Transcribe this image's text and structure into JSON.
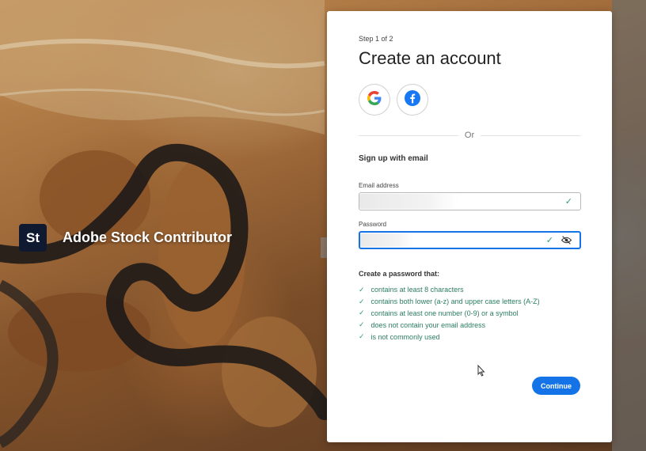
{
  "brand": {
    "logo_text": "St",
    "name": "Adobe Stock Contributor"
  },
  "form": {
    "step": "Step 1 of 2",
    "title": "Create an account",
    "social": [
      {
        "provider": "Google",
        "icon": "google-icon"
      },
      {
        "provider": "Facebook",
        "icon": "facebook-icon"
      }
    ],
    "divider_text": "Or",
    "subhead": "Sign up with email",
    "email": {
      "label": "Email address",
      "value": "",
      "valid": true
    },
    "password": {
      "label": "Password",
      "value": "",
      "valid": true,
      "toggle_icon": "eye-slash-icon"
    },
    "requirements_title": "Create a password that:",
    "requirements": [
      "contains at least 8 characters",
      "contains both lower (a-z) and upper case letters (A-Z)",
      "contains at least one number (0-9) or a symbol",
      "does not contain your email address",
      "is not commonly used"
    ],
    "continue_label": "Continue"
  },
  "colors": {
    "accent": "#1473e6",
    "success": "#2d9d78",
    "brand_logo_bg": "#0f1a30"
  }
}
